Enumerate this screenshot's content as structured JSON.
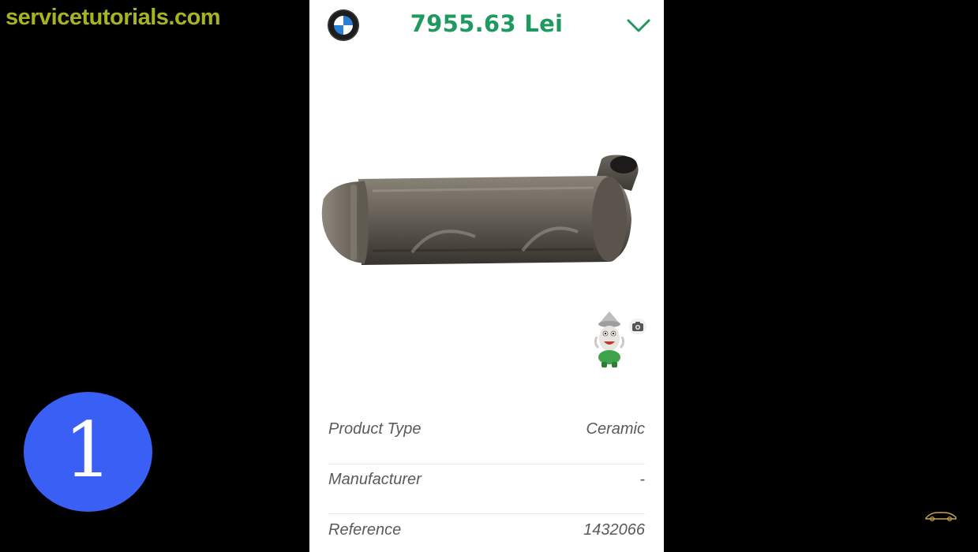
{
  "watermark": {
    "text": "servicetutorials.com",
    "color": "#a8b324"
  },
  "step_badge": {
    "number": "1",
    "color": "#3a5ff5"
  },
  "header": {
    "brand_icon": "bmw-logo-icon",
    "price": "7955.63 Lei",
    "price_color": "#1e9a5e",
    "expand_icon": "chevron-down-icon"
  },
  "product": {
    "image": "catalytic-converter-photo",
    "mascot": "mascot-figure",
    "camera_icon": "camera-icon"
  },
  "specs": [
    {
      "label": "Product Type",
      "value": "Ceramic"
    },
    {
      "label": "Manufacturer",
      "value": "-"
    },
    {
      "label": "Reference",
      "value": "1432066"
    }
  ]
}
